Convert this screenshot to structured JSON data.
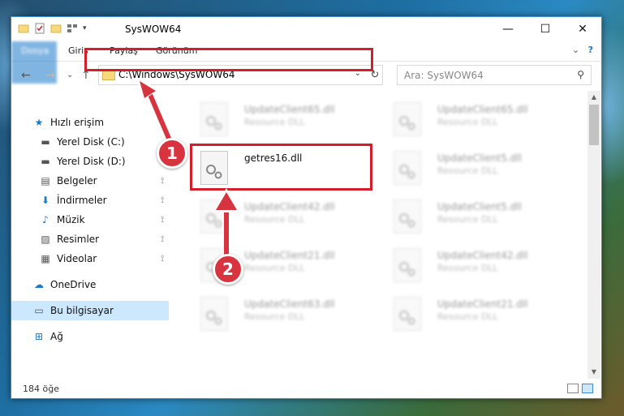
{
  "window": {
    "title": "SysWOW64",
    "controls": {
      "minimize": "—",
      "maximize": "☐",
      "close": "✕"
    }
  },
  "ribbon": {
    "tabs": [
      "Dosya",
      "Giriş",
      "Paylaş",
      "Görünüm"
    ],
    "expand_glyph": "⌄",
    "help_glyph": "?"
  },
  "navigation": {
    "back": "←",
    "forward": "→",
    "recent": "⌄",
    "up": "↑",
    "address": "C:\\Windows\\SysWOW64",
    "address_dropdown": "⌄",
    "refresh": "↻",
    "search_placeholder": "Ara: SysWOW64",
    "search_glyph": "⚲"
  },
  "sidebar": {
    "items": [
      {
        "label": "Hızlı erişim",
        "icon": "star-icon",
        "glyph": "★",
        "pinned": false
      },
      {
        "label": "Yerel Disk (C:)",
        "icon": "drive-icon",
        "glyph": "▬",
        "pinned": false
      },
      {
        "label": "Yerel Disk (D:)",
        "icon": "drive-icon",
        "glyph": "▬",
        "pinned": true
      },
      {
        "label": "Belgeler",
        "icon": "documents-icon",
        "glyph": "▤",
        "pinned": true
      },
      {
        "label": "İndirmeler",
        "icon": "download-icon",
        "glyph": "⬇",
        "pinned": true
      },
      {
        "label": "Müzik",
        "icon": "music-icon",
        "glyph": "♪",
        "pinned": true
      },
      {
        "label": "Resimler",
        "icon": "pictures-icon",
        "glyph": "▨",
        "pinned": true
      },
      {
        "label": "Videolar",
        "icon": "video-icon",
        "glyph": "▦",
        "pinned": true
      },
      {
        "label": "OneDrive",
        "icon": "cloud-icon",
        "glyph": "☁",
        "pinned": false
      },
      {
        "label": "Bu bilgisayar",
        "icon": "computer-icon",
        "glyph": "▭",
        "pinned": false,
        "selected": true
      },
      {
        "label": "Ağ",
        "icon": "network-icon",
        "glyph": "⊞",
        "pinned": false
      }
    ],
    "pin_glyph": "📌"
  },
  "files": [
    {
      "name": "UpdateClient65.dll",
      "type": "Resource DLL"
    },
    {
      "name": "UpdateClient65.dll",
      "type": "Resource DLL"
    },
    {
      "name": "getres16.dll",
      "type": ""
    },
    {
      "name": "UpdateClient5.dll",
      "type": "Resource DLL"
    },
    {
      "name": "UpdateClient42.dll",
      "type": "Resource DLL"
    },
    {
      "name": "UpdateClient5.dll",
      "type": "Resource DLL"
    },
    {
      "name": "UpdateClient21.dll",
      "type": "Resource DLL"
    },
    {
      "name": "UpdateClient42.dll",
      "type": "Resource DLL"
    },
    {
      "name": "UpdateClient63.dll",
      "type": "Resource DLL"
    },
    {
      "name": "UpdateClient21.dll",
      "type": "Resource DLL"
    }
  ],
  "status": {
    "item_count": "184 öğe"
  },
  "annotations": [
    {
      "label": "1"
    },
    {
      "label": "2"
    }
  ],
  "colors": {
    "highlight": "#d21f2a",
    "ribbon_file": "#1979ca",
    "selection": "#cce8ff"
  }
}
